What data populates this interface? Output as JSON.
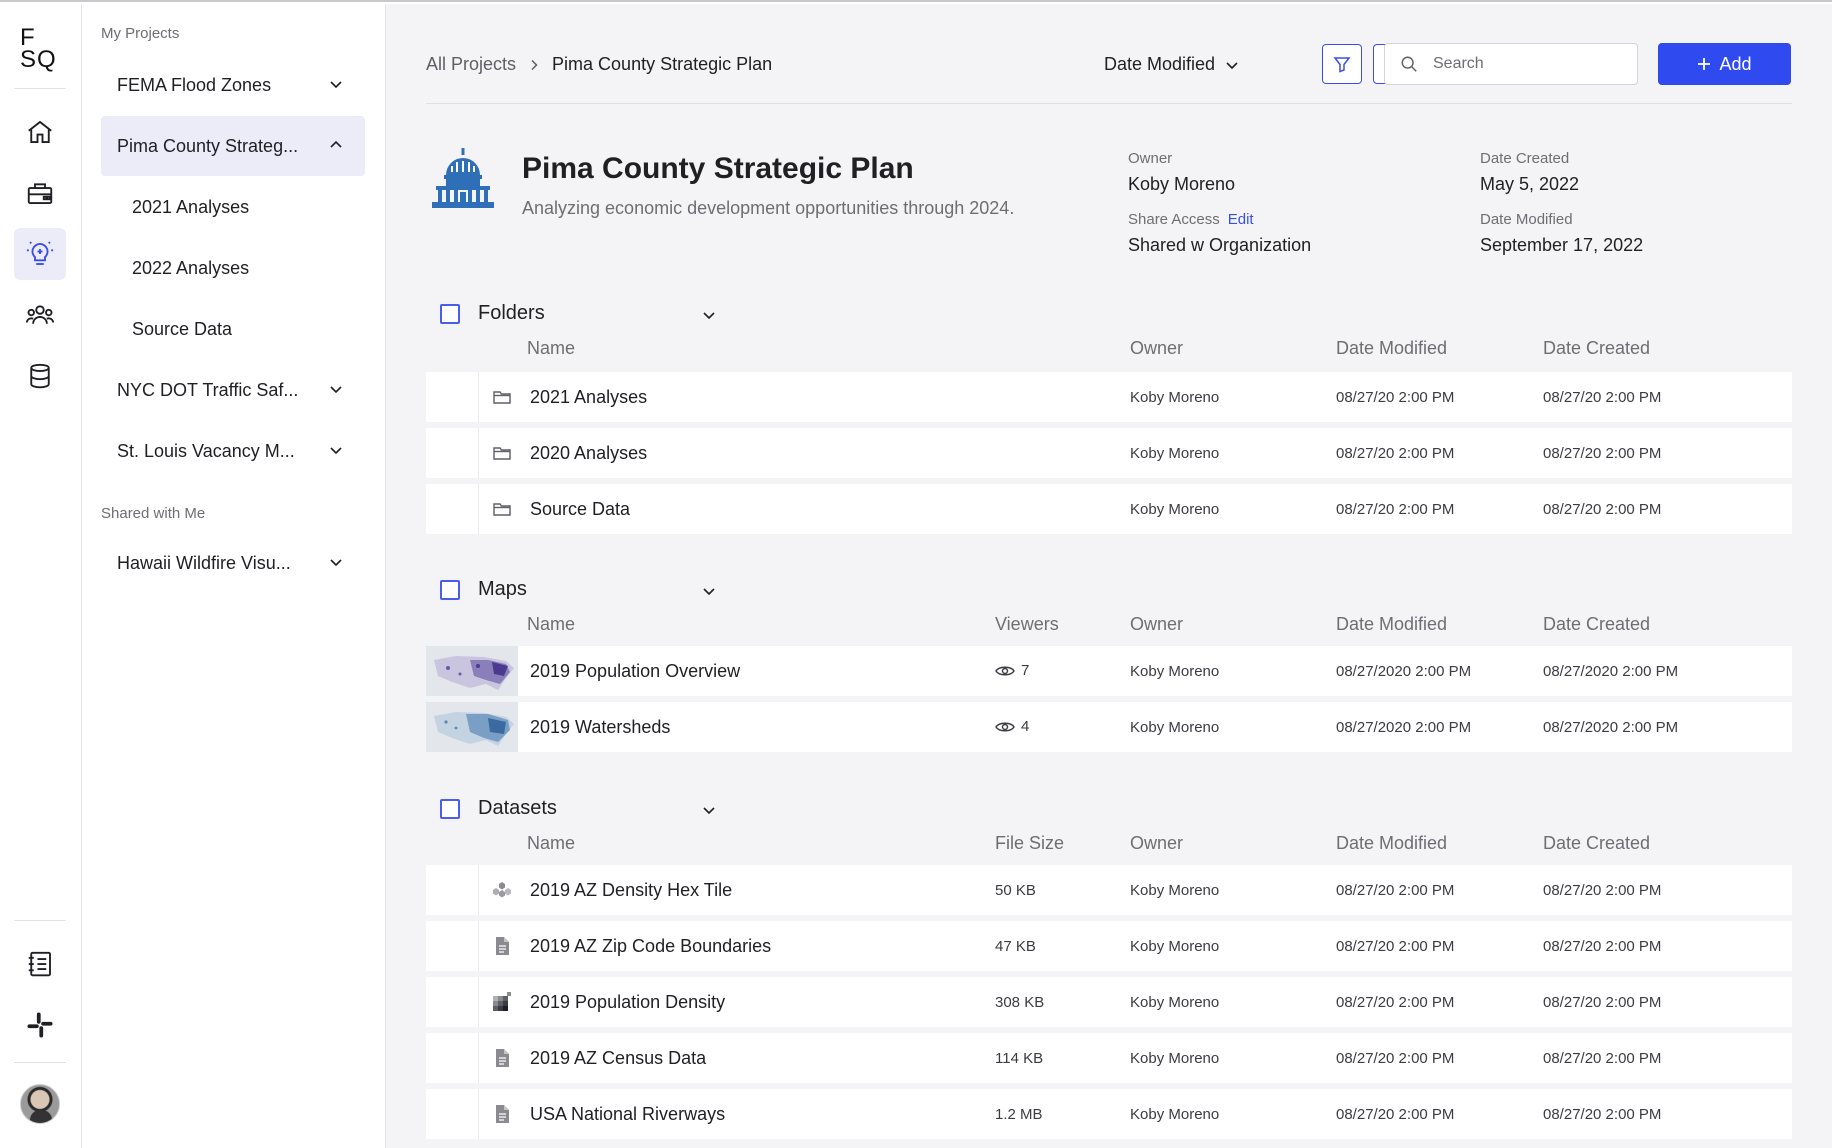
{
  "logo": {
    "line1": "F",
    "line2": "SQ"
  },
  "rail": {
    "icons": [
      "home-icon",
      "briefcase-icon",
      "lightbulb-icon",
      "team-icon",
      "database-icon",
      "notebook-icon",
      "slack-icon"
    ],
    "active": "lightbulb-icon"
  },
  "sidebar": {
    "my_projects_label": "My Projects",
    "shared_label": "Shared with Me",
    "projects": [
      {
        "label": "FEMA Flood Zones"
      },
      {
        "label": "Pima County Strateg..."
      },
      {
        "label": "NYC DOT Traffic Saf..."
      },
      {
        "label": "St. Louis Vacancy M..."
      }
    ],
    "subitems": [
      {
        "label": "2021 Analyses"
      },
      {
        "label": "2022 Analyses"
      },
      {
        "label": "Source Data"
      }
    ],
    "shared_projects": [
      {
        "label": "Hawaii Wildfire Visu..."
      }
    ]
  },
  "breadcrumb": {
    "root": "All Projects",
    "current": "Pima County Strategic Plan"
  },
  "toolbar": {
    "sort_label": "Date Modified",
    "search_placeholder": "Search",
    "add_label": "Add",
    "accent": "#2f4bf0"
  },
  "project": {
    "title": "Pima County Strategic Plan",
    "description": "Analyzing economic development opportunities through 2024.",
    "owner_label": "Owner",
    "owner": "Koby Moreno",
    "share_label": "Share Access",
    "share_edit": "Edit",
    "share_value": "Shared w Organization",
    "created_label": "Date Created",
    "created": "May 5, 2022",
    "modified_label": "Date Modified",
    "modified": "September 17, 2022"
  },
  "folders": {
    "title": "Folders",
    "columns": [
      "Name",
      "Owner",
      "Date Modified",
      "Date Created"
    ],
    "rows": [
      {
        "name": "2021 Analyses",
        "owner": "Koby Moreno",
        "modified": "08/27/20 2:00 PM",
        "created": "08/27/20 2:00 PM"
      },
      {
        "name": "2020 Analyses",
        "owner": "Koby Moreno",
        "modified": "08/27/20 2:00 PM",
        "created": "08/27/20 2:00 PM"
      },
      {
        "name": "Source Data",
        "owner": "Koby Moreno",
        "modified": "08/27/20 2:00 PM",
        "created": "08/27/20 2:00 PM"
      }
    ]
  },
  "maps": {
    "title": "Maps",
    "columns": [
      "Name",
      "Viewers",
      "Owner",
      "Date Modified",
      "Date Created"
    ],
    "rows": [
      {
        "name": "2019 Population Overview",
        "viewers": "7",
        "owner": "Koby Moreno",
        "modified": "08/27/2020 2:00 PM",
        "created": "08/27/2020 2:00 PM"
      },
      {
        "name": "2019 Watersheds",
        "viewers": "4",
        "owner": "Koby Moreno",
        "modified": "08/27/2020 2:00 PM",
        "created": "08/27/2020 2:00 PM"
      }
    ]
  },
  "datasets": {
    "title": "Datasets",
    "columns": [
      "Name",
      "File Size",
      "Owner",
      "Date Modified",
      "Date Created"
    ],
    "rows": [
      {
        "name": "2019 AZ Density Hex Tile",
        "size": "50 KB",
        "owner": "Koby Moreno",
        "modified": "08/27/20 2:00 PM",
        "created": "08/27/20 2:00 PM",
        "icon": "hex-tile-icon"
      },
      {
        "name": "2019 AZ Zip Code Boundaries",
        "size": "47 KB",
        "owner": "Koby Moreno",
        "modified": "08/27/20 2:00 PM",
        "created": "08/27/20 2:00 PM",
        "icon": "file-icon"
      },
      {
        "name": "2019 Population Density",
        "size": "308 KB",
        "owner": "Koby Moreno",
        "modified": "08/27/20 2:00 PM",
        "created": "08/27/20 2:00 PM",
        "icon": "raster-icon"
      },
      {
        "name": "2019 AZ Census Data",
        "size": "114 KB",
        "owner": "Koby Moreno",
        "modified": "08/27/20 2:00 PM",
        "created": "08/27/20 2:00 PM",
        "icon": "file-icon"
      },
      {
        "name": "USA National Riverways",
        "size": "1.2 MB",
        "owner": "Koby Moreno",
        "modified": "08/27/20 2:00 PM",
        "created": "08/27/20 2:00 PM",
        "icon": "file-icon"
      }
    ]
  }
}
